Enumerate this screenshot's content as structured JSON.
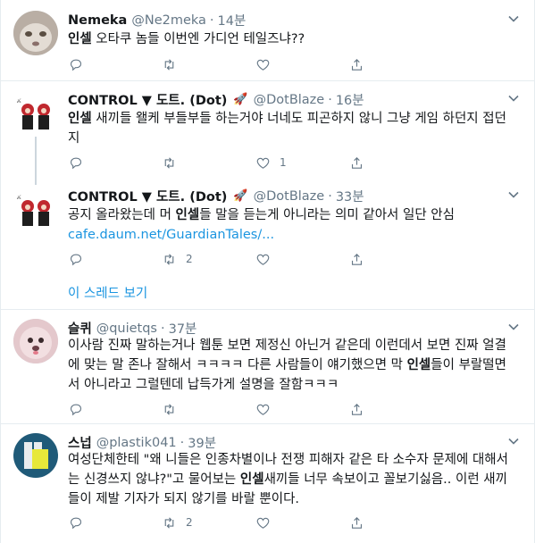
{
  "tweets": [
    {
      "name": "Nemeka",
      "handle": "@Ne2meka",
      "time": "14분",
      "body_html": "<b>인셀</b> 오타쿠 놈들 이번엔 가디언 테일즈냐??",
      "reply_count": "",
      "retweet_count": "",
      "like_count": ""
    },
    {
      "name": "CONTROL ▼ 도트. (Dot)",
      "handle": "@DotBlaze",
      "time": "16분",
      "body_html": "<b>인셀</b> 새끼들 왤케 부들부들 하는거야 너네도 피곤하지 않니 그냥 게임 하던지 접던지",
      "reply_count": "",
      "retweet_count": "",
      "like_count": "1"
    },
    {
      "name": "CONTROL ▼ 도트. (Dot)",
      "handle": "@DotBlaze",
      "time": "33분",
      "body_html": "공지 올라왔는데 머 <b>인셀</b>들 말을 듣는게 아니라는 의미 같아서 일단 안심",
      "link": "cafe.daum.net/GuardianTales/...",
      "reply_count": "",
      "retweet_count": "2",
      "like_count": ""
    },
    {
      "name": "슬퀴",
      "handle": "@quietqs",
      "time": "37분",
      "body_html": "이사람 진짜 말하는거나 웹툰 보면 제정신 아닌거 같은데 이런데서 보면 진짜 얼결에 맞는 말 존나 잘해서 ㅋㅋㅋㅋ 다른 사람들이 얘기했으면 막 <b>인셀</b>들이 부랄떨면서 아니라고 그럴텐데 납득가게 설명을 잘함ㅋㅋㅋ",
      "reply_count": "",
      "retweet_count": "",
      "like_count": ""
    },
    {
      "name": "스넙",
      "handle": "@plastik041",
      "time": "39분",
      "body_html": "여성단체한테 \"왜 니들은 인종차별이나 전쟁 피해자 같은 타 소수자 문제에 대해서는 신경쓰지 않냐?\"고 물어보는 <b>인셀</b>새끼들 너무 속보이고 꼴보기싫음.. 이런 새끼들이 제발 기자가 되지 않기를 바랄 뿐이다.",
      "reply_count": "",
      "retweet_count": "2",
      "like_count": ""
    }
  ],
  "show_thread_label": "이 스레드 보기",
  "rocket_icon": "🚀",
  "colors": {
    "link": "#1b95e0",
    "muted": "#657786",
    "border": "#e6ecf0"
  }
}
